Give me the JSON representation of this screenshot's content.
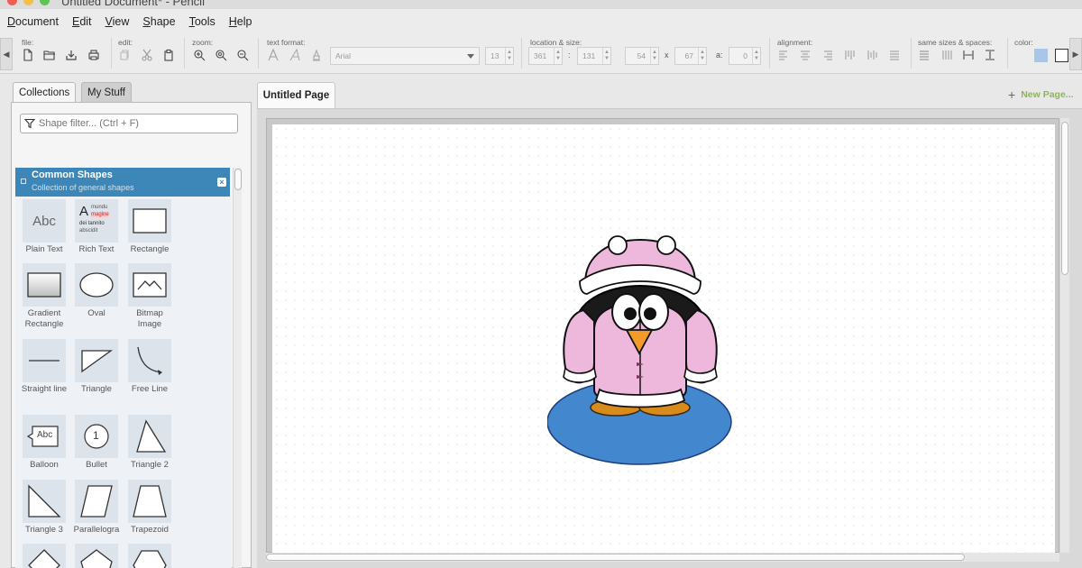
{
  "window": {
    "title": "Untitled Document* - Pencil",
    "traffic_colors": [
      "#ee5d52",
      "#f4bd4f",
      "#5fc454"
    ]
  },
  "menu": [
    "Document",
    "Edit",
    "View",
    "Shape",
    "Tools",
    "Help"
  ],
  "toolbar": {
    "groups": {
      "file": "file:",
      "edit": "edit:",
      "zoom": "zoom:",
      "text_format": "text format:",
      "location_size": "location & size:",
      "alignment": "alignment:",
      "same_sizes": "same sizes & spaces:",
      "color": "color:"
    },
    "font_name": "Arial",
    "font_size": "13",
    "x": "361",
    "y": "131",
    "width": "54",
    "height": "67",
    "angle": "0",
    "xy_separator": ":",
    "size_separator": "x",
    "angle_label": "a:",
    "fill_color": "#a9c5e8"
  },
  "left_panel": {
    "tabs": [
      "Collections",
      "My Stuff"
    ],
    "filter_placeholder": "Shape filter... (Ctrl + F)",
    "collection": {
      "name": "Common Shapes",
      "description": "Collection of general shapes"
    },
    "shapes": [
      {
        "label": "Plain Text",
        "icon": "plain-text-icon"
      },
      {
        "label": "Rich Text",
        "icon": "rich-text-icon"
      },
      {
        "label": "Rectangle",
        "icon": "rectangle-icon"
      },
      {
        "label": "Gradient Rectangle",
        "icon": "gradient-rectangle-icon"
      },
      {
        "label": "Oval",
        "icon": "oval-icon"
      },
      {
        "label": "Bitmap Image",
        "icon": "bitmap-image-icon"
      },
      {
        "label": "Straight line",
        "icon": "straight-line-icon"
      },
      {
        "label": "Triangle",
        "icon": "triangle-icon"
      },
      {
        "label": "Free Line",
        "icon": "free-line-icon"
      },
      {
        "label": "Balloon",
        "icon": "balloon-icon"
      },
      {
        "label": "Bullet",
        "icon": "bullet-icon"
      },
      {
        "label": "Triangle 2",
        "icon": "triangle-2-icon"
      },
      {
        "label": "Triangle 3",
        "icon": "triangle-3-icon"
      },
      {
        "label": "Parallelogra",
        "icon": "parallelogram-icon"
      },
      {
        "label": "Trapezoid",
        "icon": "trapezoid-icon"
      },
      {
        "label": "",
        "icon": "diamond-icon"
      },
      {
        "label": "",
        "icon": "pentagon-icon"
      },
      {
        "label": "",
        "icon": "hexagon-icon"
      }
    ],
    "plain_text_sample": "Abc",
    "balloon_sample": "Abc",
    "bullet_sample": "1",
    "rich_text_sample": {
      "big": "A",
      "lines": [
        "mundu",
        "magine",
        "dei tannito",
        "abscidit"
      ]
    }
  },
  "main": {
    "page_tab": "Untitled Page",
    "new_page_label": "New Page..."
  }
}
